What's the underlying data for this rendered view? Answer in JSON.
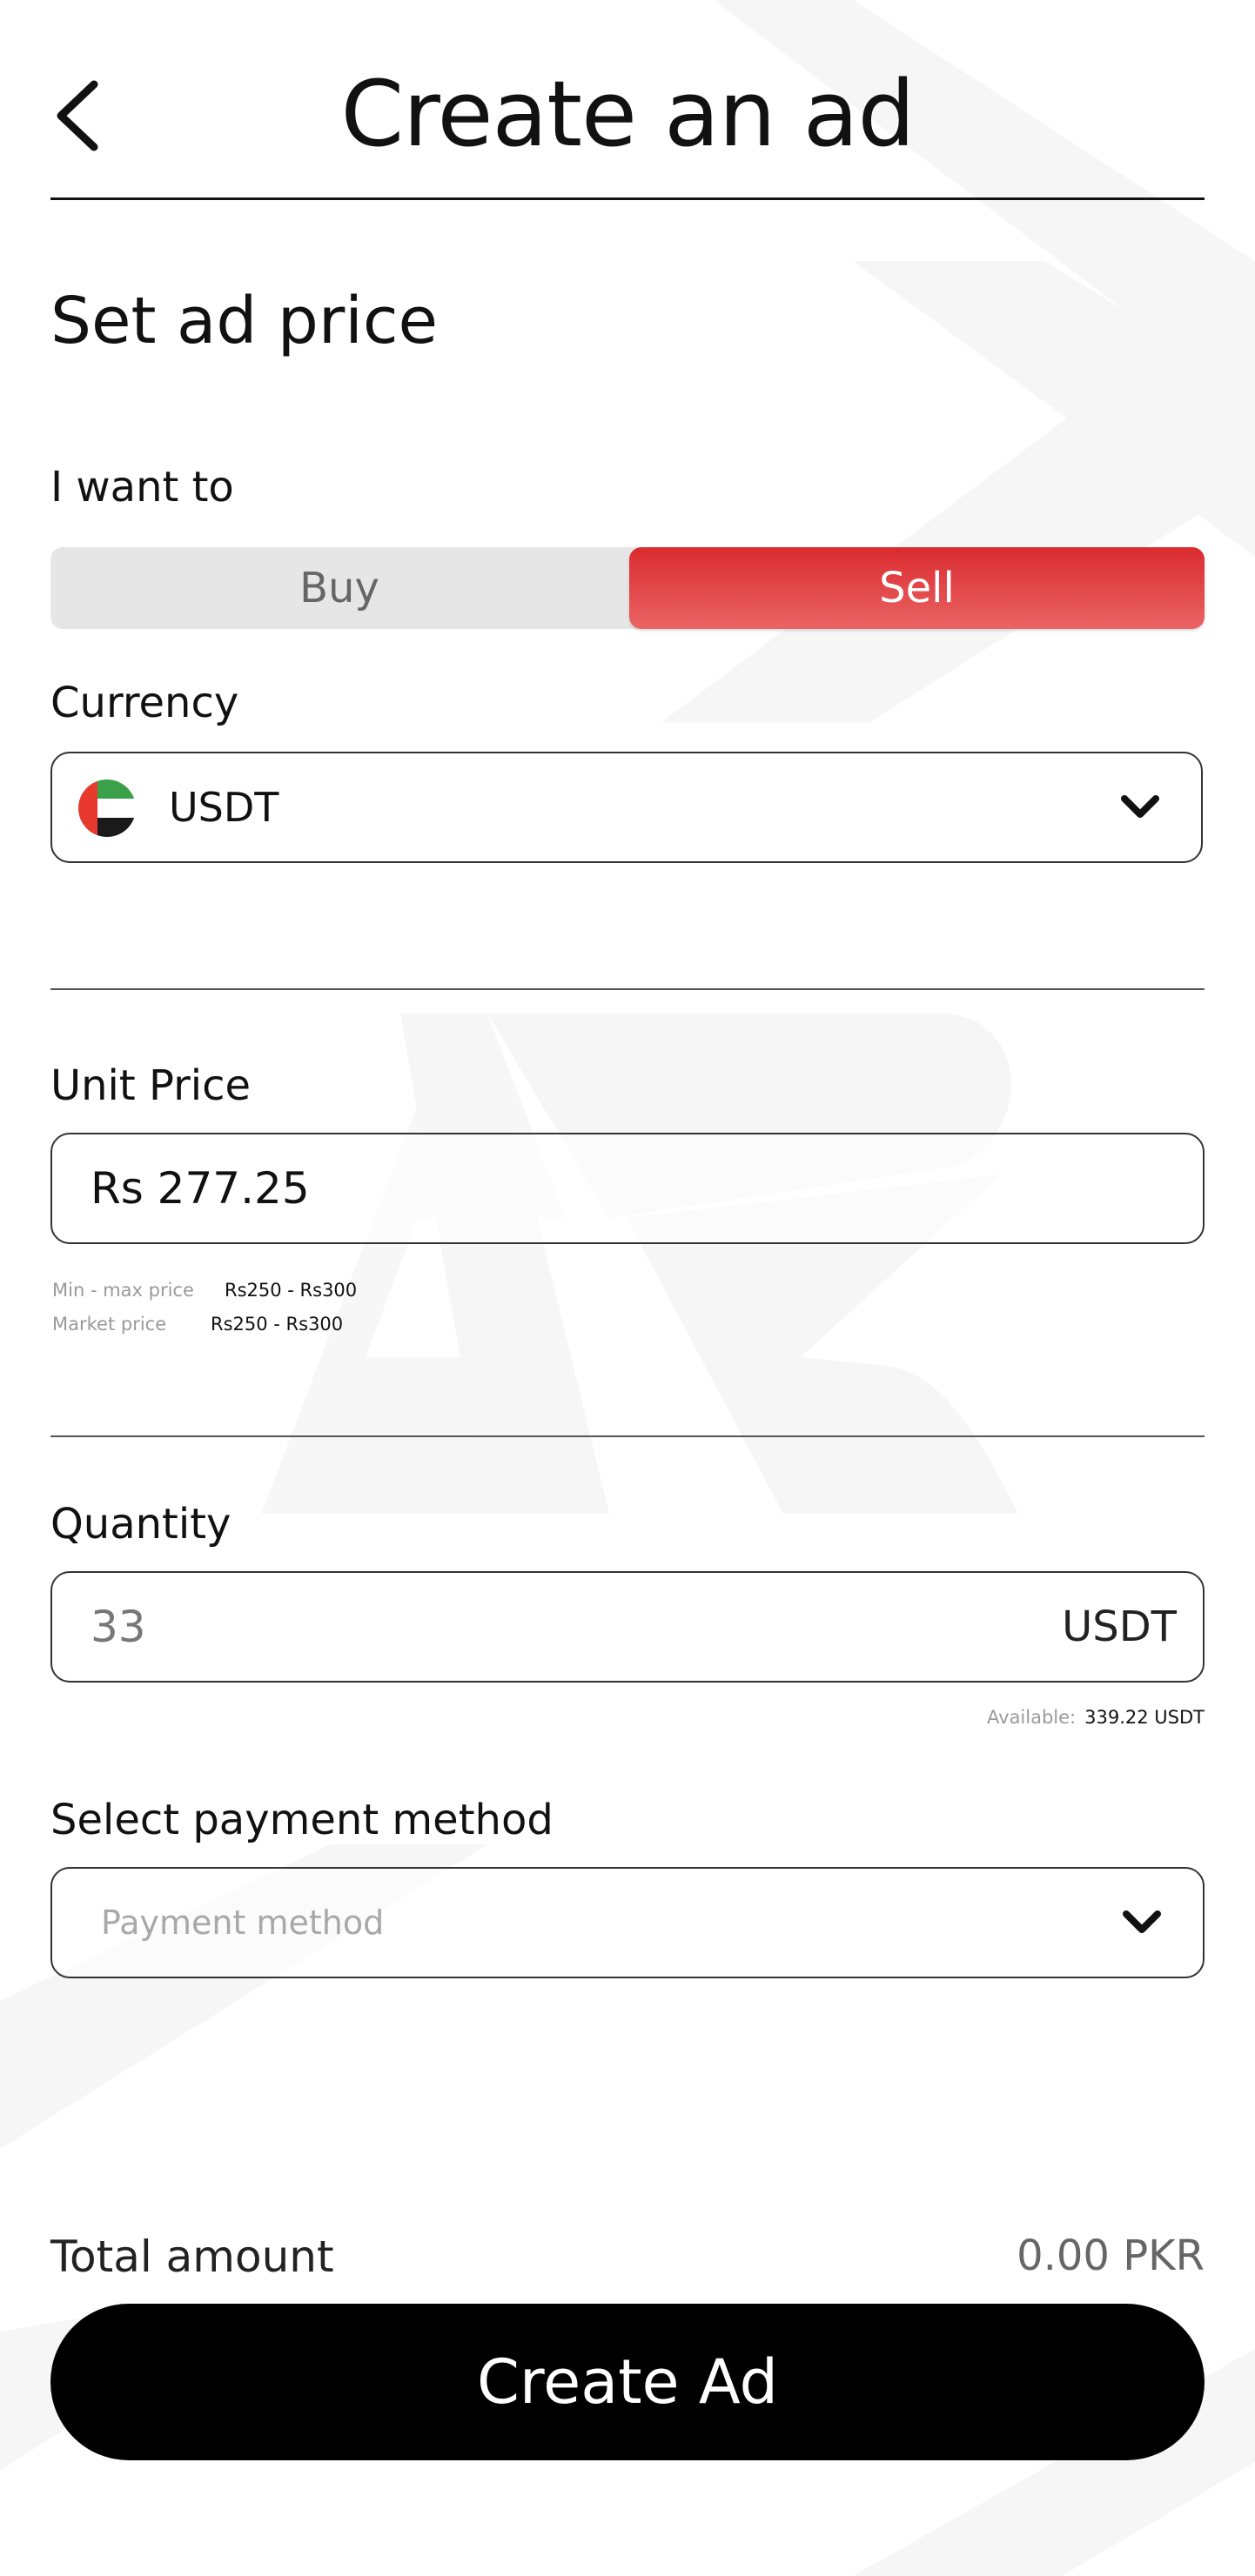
{
  "header": {
    "title": "Create an ad",
    "back_icon": "chevron-left-icon"
  },
  "section_title": "Set ad price",
  "trade_side": {
    "label": "I want to",
    "options": [
      "Buy",
      "Sell"
    ],
    "selected": "Sell"
  },
  "currency": {
    "label": "Currency",
    "value": "USDT",
    "flag_icon": "uae-flag-icon"
  },
  "unit_price": {
    "label": "Unit Price",
    "value": "Rs 277.25",
    "minmax_label": "Min - max price",
    "minmax_value": "Rs250 - Rs300",
    "market_label": "Market price",
    "market_value": "Rs250 - Rs300"
  },
  "quantity": {
    "label": "Quantity",
    "placeholder": "33",
    "unit": "USDT",
    "available_label": "Available:",
    "available_value": "339.22 USDT"
  },
  "payment": {
    "label": "Select payment method",
    "placeholder": "Payment method"
  },
  "total": {
    "label": "Total amount",
    "value": "0.00 PKR"
  },
  "cta": {
    "label": "Create Ad"
  },
  "colors": {
    "accent": "#e0393b",
    "primary_button": "#000000",
    "toggle_bg": "#e6e6e6"
  }
}
